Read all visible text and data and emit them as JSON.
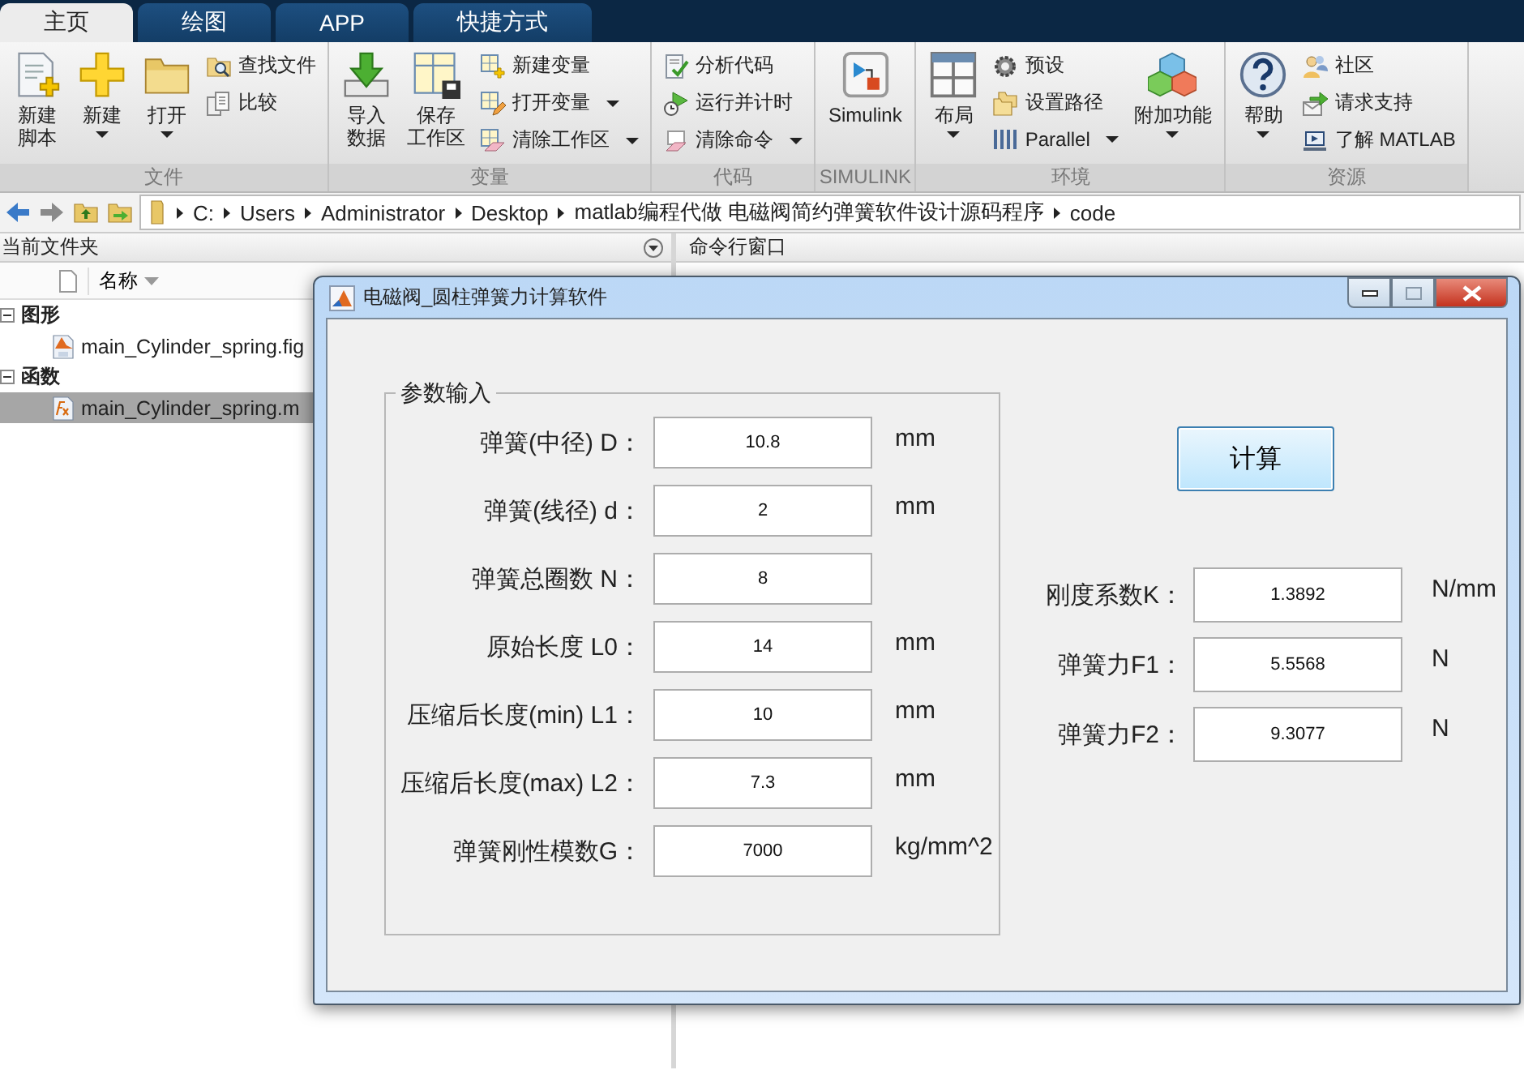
{
  "tabs": [
    {
      "label": "主页",
      "selected": true
    },
    {
      "label": "绘图",
      "selected": false
    },
    {
      "label": "APP",
      "selected": false
    },
    {
      "label": "快捷方式",
      "selected": false
    }
  ],
  "ribbon": {
    "groups": [
      {
        "label": "文件",
        "items": [
          {
            "kind": "large",
            "label": [
              "新建",
              "脚本"
            ],
            "dropdown": false
          },
          {
            "kind": "large",
            "label": "新建",
            "dropdown": true
          },
          {
            "kind": "large",
            "label": "打开",
            "dropdown": true
          },
          {
            "kind": "stack",
            "items": [
              {
                "label": "查找文件",
                "dropdown": false
              },
              {
                "label": "比较",
                "dropdown": false
              }
            ]
          }
        ]
      },
      {
        "label": "变量",
        "items": [
          {
            "kind": "large",
            "label": [
              "导入",
              "数据"
            ],
            "dropdown": false
          },
          {
            "kind": "large",
            "label": [
              "保存",
              "工作区"
            ],
            "dropdown": false
          },
          {
            "kind": "stack",
            "items": [
              {
                "label": "新建变量",
                "dropdown": false
              },
              {
                "label": "打开变量",
                "dropdown": true
              },
              {
                "label": "清除工作区",
                "dropdown": true
              }
            ]
          }
        ]
      },
      {
        "label": "代码",
        "items": [
          {
            "kind": "stack",
            "items": [
              {
                "label": "分析代码",
                "dropdown": false
              },
              {
                "label": "运行并计时",
                "dropdown": false
              },
              {
                "label": "清除命令",
                "dropdown": true
              }
            ]
          }
        ]
      },
      {
        "label": "SIMULINK",
        "items": [
          {
            "kind": "large",
            "label": "Simulink",
            "dropdown": false
          }
        ]
      },
      {
        "label": "环境",
        "items": [
          {
            "kind": "large",
            "label": "布局",
            "dropdown": true
          },
          {
            "kind": "stack",
            "items": [
              {
                "label": "预设",
                "dropdown": false
              },
              {
                "label": "设置路径",
                "dropdown": false
              },
              {
                "label": "Parallel",
                "dropdown": true
              }
            ]
          },
          {
            "kind": "large",
            "label": "附加功能",
            "dropdown": true
          }
        ]
      },
      {
        "label": "资源",
        "items": [
          {
            "kind": "large",
            "label": "帮助",
            "dropdown": true
          },
          {
            "kind": "stack",
            "items": [
              {
                "label": "社区",
                "dropdown": false
              },
              {
                "label": "请求支持",
                "dropdown": false
              },
              {
                "label": "了解 MATLAB",
                "dropdown": false
              }
            ]
          }
        ]
      }
    ]
  },
  "address_bar": {
    "path": [
      "C:",
      "Users",
      "Administrator",
      "Desktop",
      "matlab编程代做 电磁阀简约弹簧软件设计源码程序",
      "code"
    ]
  },
  "current_folder": {
    "title": "当前文件夹",
    "column": "名称",
    "tree": [
      {
        "label": "图形",
        "expanded": true,
        "selected": false,
        "children": [
          {
            "label": "main_Cylinder_spring.fig",
            "kind": "figure",
            "selected": false
          }
        ]
      },
      {
        "label": "函数",
        "expanded": true,
        "selected": false,
        "children": [
          {
            "label": "main_Cylinder_spring.m",
            "kind": "function",
            "selected": true
          }
        ]
      }
    ]
  },
  "command_window": {
    "title": "命令行窗口"
  },
  "dialog": {
    "title": "电磁阀_圆柱弹簧力计算软件",
    "panel_title": "参数输入",
    "inputs": [
      {
        "label": "弹簧(中径) D：",
        "value": "10.8",
        "unit": "mm"
      },
      {
        "label": "弹簧(线径) d：",
        "value": "2",
        "unit": "mm"
      },
      {
        "label": "弹簧总圈数 N：",
        "value": "8"
      },
      {
        "label": "原始长度 L0：",
        "value": "14",
        "unit": "mm"
      },
      {
        "label": "压缩后长度(min) L1：",
        "value": "10",
        "unit": "mm"
      },
      {
        "label": "压缩后长度(max) L2：",
        "value": "7.3",
        "unit": "mm"
      },
      {
        "label": "弹簧刚性模数G：",
        "value": "7000",
        "unit": "kg/mm^2"
      }
    ],
    "button": "计算",
    "results": [
      {
        "label": "刚度系数K：",
        "value": "1.3892",
        "unit": "N/mm"
      },
      {
        "label": "弹簧力F1：",
        "value": "5.5568",
        "unit": "N"
      },
      {
        "label": "弹簧力F2：",
        "value": "9.3077",
        "unit": "N"
      }
    ]
  }
}
